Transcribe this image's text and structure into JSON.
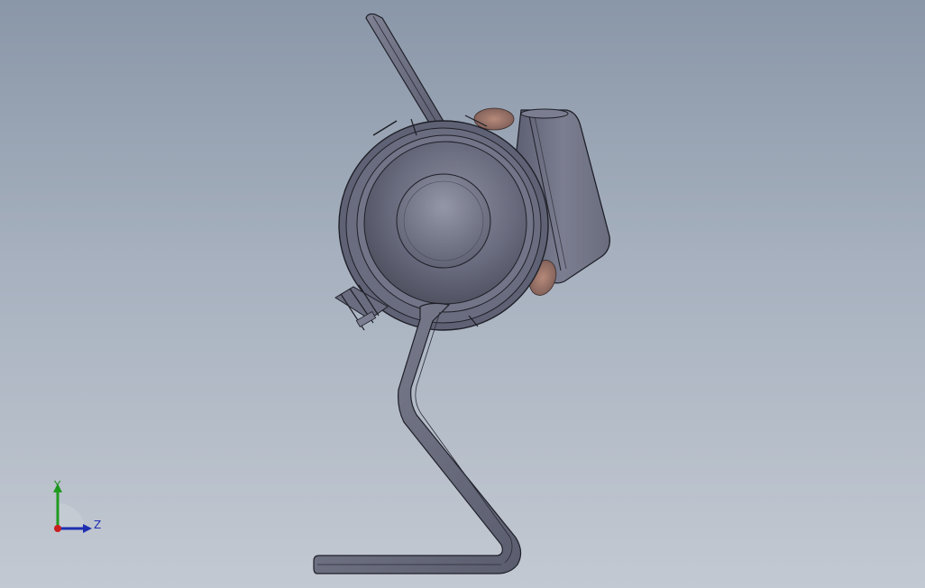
{
  "viewport": {
    "background_top": "#8a97a8",
    "background_bottom": "#c3c9d2"
  },
  "model": {
    "body_color": "#6b6e80",
    "edge_color": "#1e1f28",
    "accent_color": "#a5796a"
  },
  "triad": {
    "y_label": "Y",
    "z_label": "Z",
    "y_color": "#1f9a1f",
    "z_color": "#1f2fb0",
    "x_color": "#c81e1e"
  }
}
